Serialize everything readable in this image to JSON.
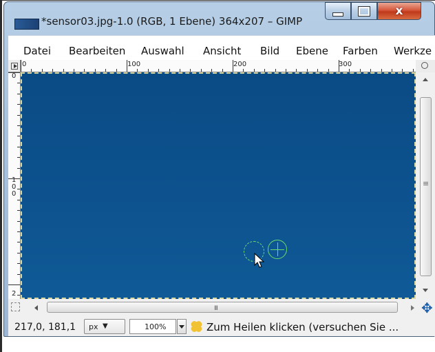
{
  "window": {
    "title": "*sensor03.jpg-1.0 (RGB, 1 Ebene) 364x207 – GIMP",
    "minimize_label": "minimize",
    "maximize_label": "maximize",
    "close_label": "x"
  },
  "menu": {
    "items": [
      "Datei",
      "Bearbeiten",
      "Auswahl",
      "Ansicht",
      "Bild",
      "Ebene",
      "Farben",
      "Werkze"
    ]
  },
  "rulers": {
    "horizontal_labels": [
      "0",
      "100",
      "200",
      "300"
    ],
    "vertical_labels": [
      "0",
      "1\n0\n0",
      "2"
    ]
  },
  "canvas": {
    "color": "#0c4f8a"
  },
  "scrollbar": {
    "grip_glyph": "III",
    "vgrip_glyph": "≡"
  },
  "statusbar": {
    "coords": "217,0, 181,1",
    "unit": "px",
    "zoom": "100%",
    "message": "Zum Heilen klicken (versuchen Sie ..."
  },
  "icons": {
    "app": "gimp-image-icon",
    "navigate": "navigate-icon",
    "heal": "heal-tool-icon"
  }
}
